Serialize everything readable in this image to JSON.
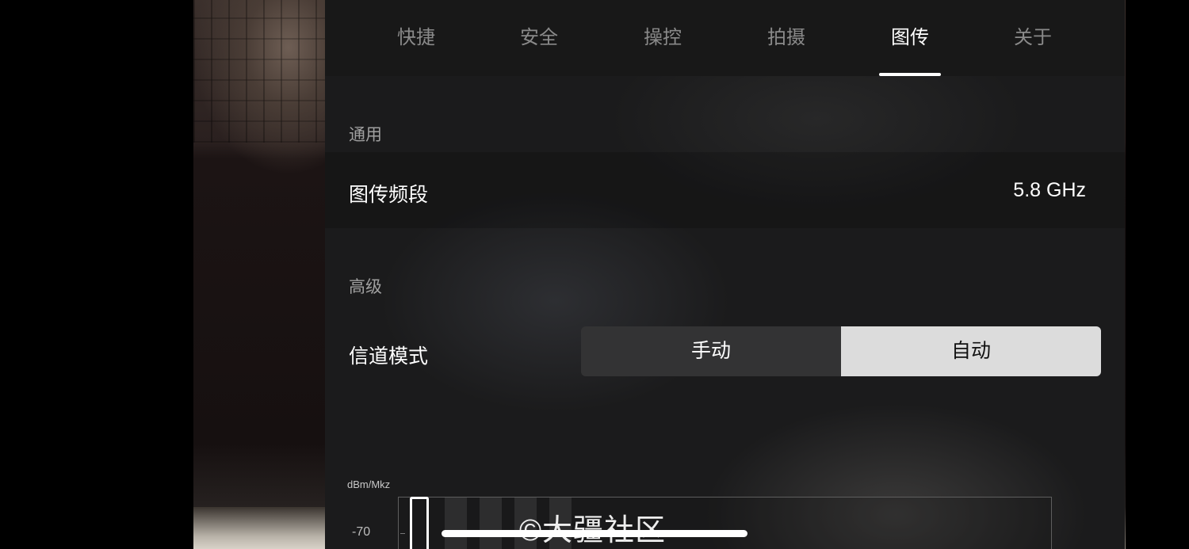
{
  "tabs": [
    {
      "label": "快捷"
    },
    {
      "label": "安全"
    },
    {
      "label": "操控"
    },
    {
      "label": "拍摄"
    },
    {
      "label": "图传",
      "active": true
    },
    {
      "label": "关于"
    }
  ],
  "general": {
    "section_label": "通用",
    "band_label": "图传频段",
    "band_value": "5.8 GHz"
  },
  "advanced": {
    "section_label": "高级",
    "channel_mode_label": "信道模式",
    "options": [
      "手动",
      "自动"
    ],
    "selected": "自动"
  },
  "spectrum": {
    "unit": "dBm/Mkz",
    "tick": "-70"
  },
  "watermark": "©大疆社区",
  "colors": {
    "panel_bg": "#1b1b1c",
    "tab_inactive": "#8a8a8a",
    "tab_active": "#ffffff",
    "segment_selected": "#dcdcdc",
    "segment_unselected": "#333334"
  }
}
